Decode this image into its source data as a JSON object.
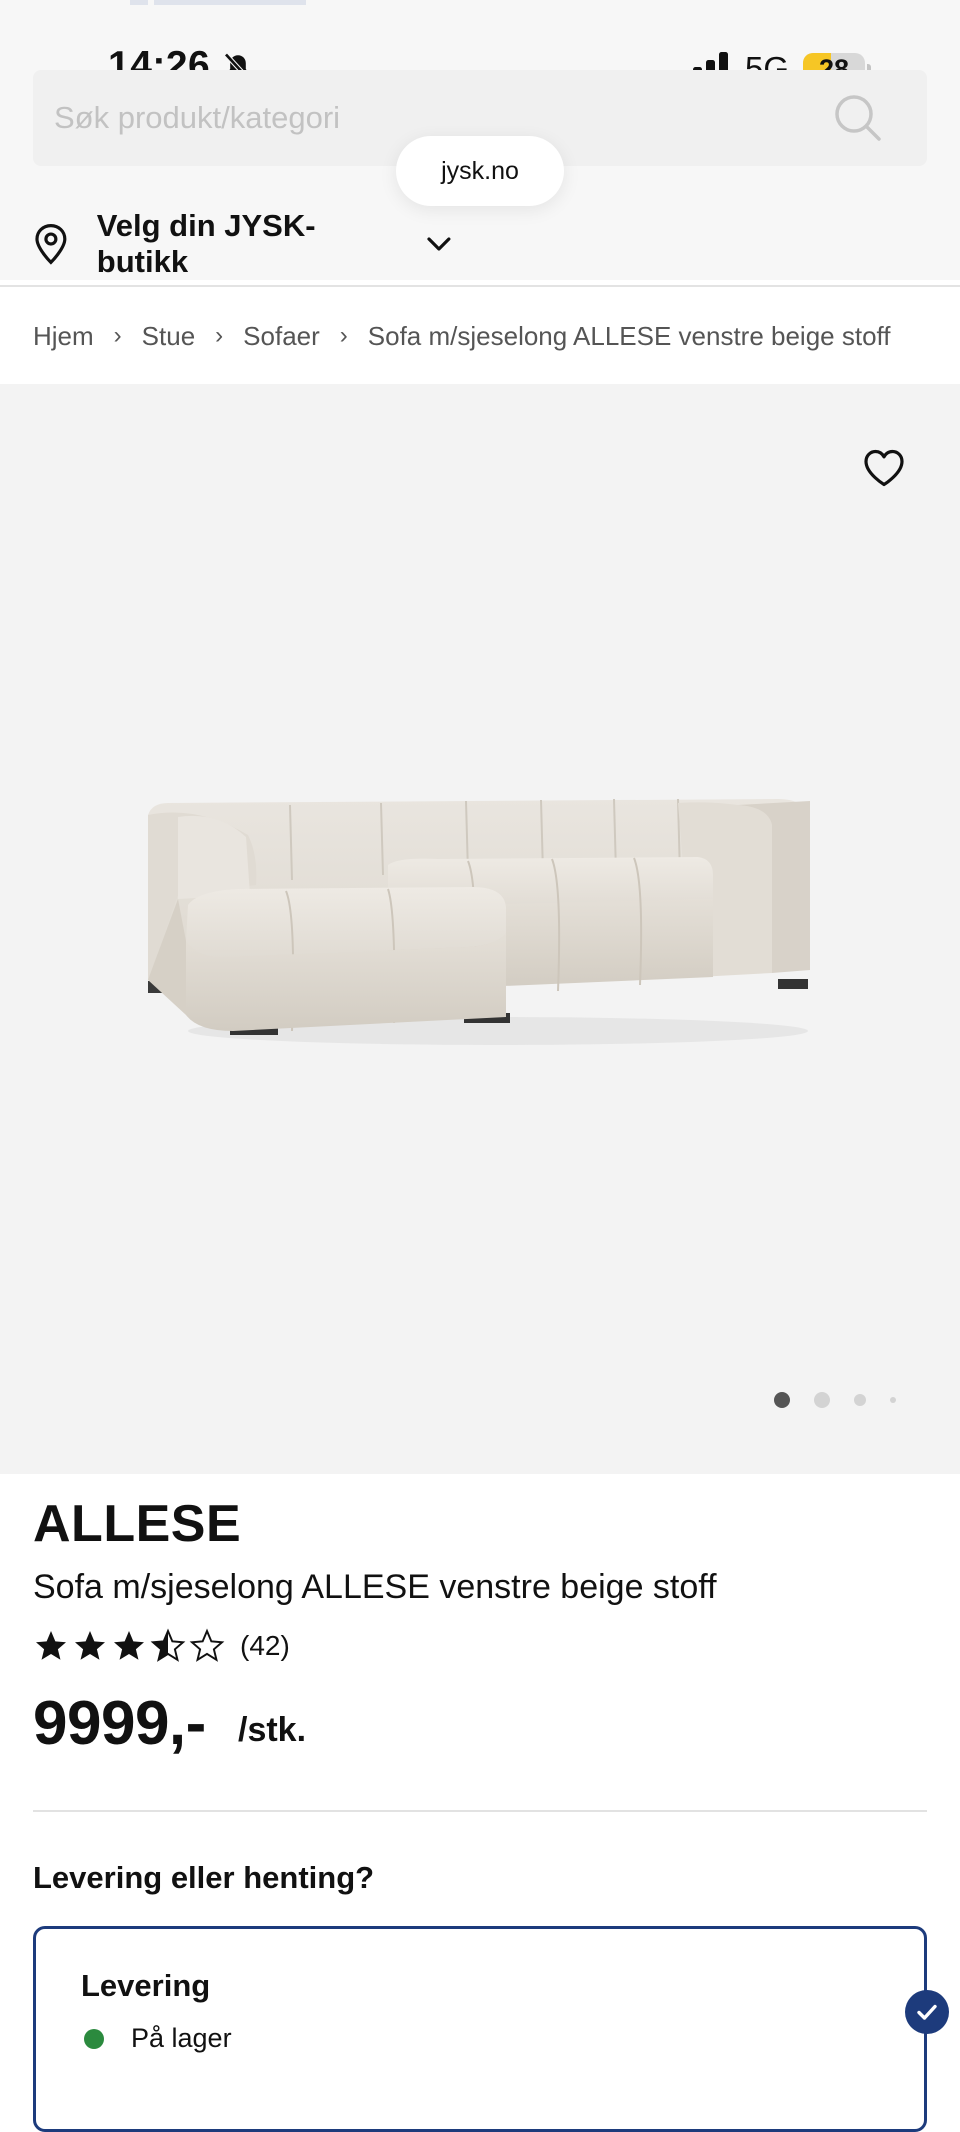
{
  "status_bar": {
    "time": "14:26",
    "network": "5G",
    "battery": "28",
    "battery_level": 0.28,
    "icons": [
      "bell-muted-icon",
      "signal-icon"
    ]
  },
  "search": {
    "placeholder": "Søk produkt/kategori",
    "icon": "search-icon"
  },
  "browser": {
    "url": "jysk.no"
  },
  "store_selector": {
    "label": "Velg din JYSK-butikk",
    "icons": [
      "pin-icon",
      "chevron-down-icon"
    ]
  },
  "breadcrumb": {
    "items": [
      "Hjem",
      "Stue",
      "Sofaer",
      "Sofa m/sjeselong ALLESE venstre beige stoff"
    ],
    "separator": "›"
  },
  "gallery": {
    "favorite_icon": "heart-icon",
    "image_alt": "sofa-image",
    "slide_count": 4,
    "active_slide": 1
  },
  "product": {
    "name": "ALLESE",
    "description": "Sofa m/sjeselong ALLESE venstre beige stoff",
    "rating": 3.5,
    "rating_max": 5,
    "review_count": "(42)",
    "price": "9999,-",
    "price_unit": "/stk."
  },
  "delivery": {
    "heading": "Levering eller henting?",
    "option_title": "Levering",
    "stock_status": "På lager",
    "selected": true
  },
  "colors": {
    "brand_navy": "#1d3b7c",
    "in_stock_green": "#2b8a3e",
    "battery_yellow": "#f6c625",
    "gallery_bg": "#f3f3f3"
  }
}
